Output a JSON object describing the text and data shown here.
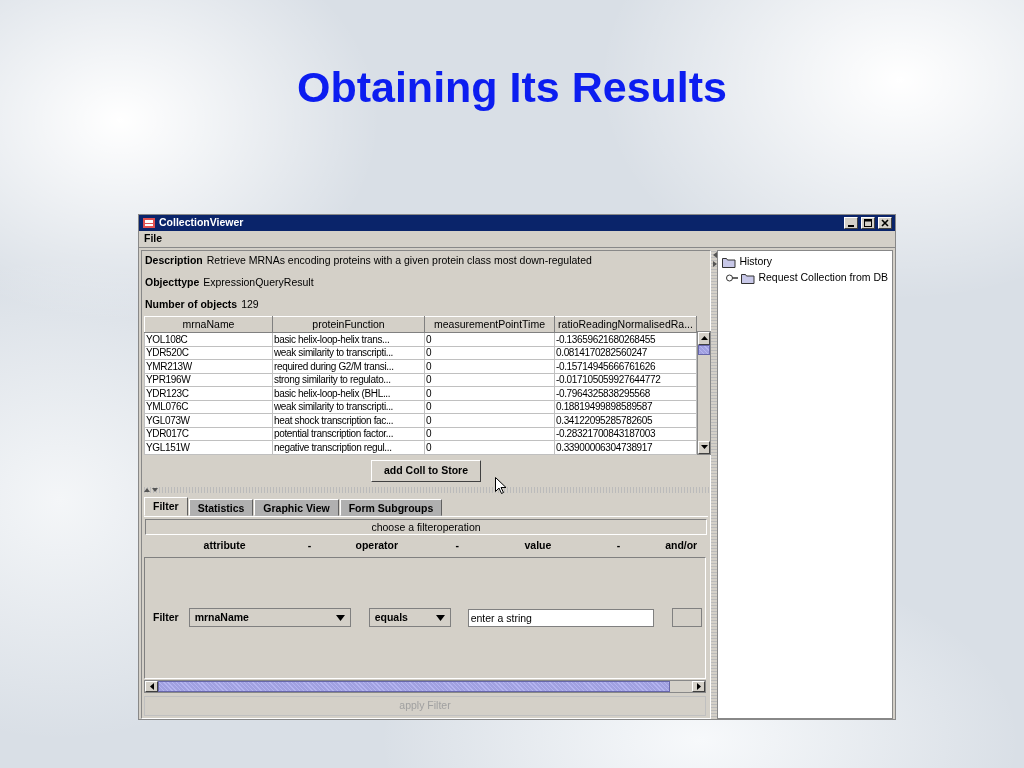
{
  "slide": {
    "title": "Obtaining Its Results"
  },
  "window": {
    "title": "CollectionViewer"
  },
  "menu": [
    "File"
  ],
  "info": [
    {
      "label": "Description",
      "value": "Retrieve MRNAs encoding proteins with a given protein class most down-regulated"
    },
    {
      "label": "Objecttype",
      "value": "ExpressionQueryResult"
    },
    {
      "label": "Number of objects",
      "value": "129"
    }
  ],
  "table": {
    "columns": [
      "mrnaName",
      "proteinFunction",
      "measurementPointTime",
      "ratioReadingNormalisedRa..."
    ],
    "rows": [
      [
        "YOL108C",
        "basic helix-loop-helix trans...",
        "0",
        "-0.13659621680268455"
      ],
      [
        "YDR520C",
        "weak similarity to transcripti...",
        "0",
        "0.0814170282560247"
      ],
      [
        "YMR213W",
        "required during G2/M transi...",
        "0",
        "-0.15714945666761626"
      ],
      [
        "YPR196W",
        "strong similarity to regulato...",
        "0",
        "-0.017105059927644772"
      ],
      [
        "YDR123C",
        "basic helix-loop-helix (BHL...",
        "0",
        "-0.7964325838295568"
      ],
      [
        "YML076C",
        "weak similarity to transcripti...",
        "0",
        "0.18819499898589587"
      ],
      [
        "YGL073W",
        "heat shock transcription fac...",
        "0",
        "0.34122095285782605"
      ],
      [
        "YDR017C",
        "potential transcription factor...",
        "0",
        "-0.28321700843187003"
      ],
      [
        "YGL151W",
        "negative transcription regul...",
        "0",
        "0.33900006304738917"
      ]
    ]
  },
  "add_button": "add Coll to Store",
  "tabs": [
    {
      "label": "Filter",
      "selected": true
    },
    {
      "label": "Statistics",
      "selected": false
    },
    {
      "label": "Graphic View",
      "selected": false
    },
    {
      "label": "Form Subgroups",
      "selected": false
    }
  ],
  "filter": {
    "hint": "choose a filteroperation",
    "headers": [
      "attribute",
      "-",
      "operator",
      "-",
      "value",
      "-",
      "and/or"
    ],
    "label": "Filter",
    "attribute": "mrnaName",
    "operator": "equals",
    "value": "enter a string"
  },
  "apply_button": {
    "label": "apply Filter",
    "disabled": true
  },
  "tree": {
    "label": "History",
    "children": [
      {
        "label": "Request Collection from DB",
        "expanded": false
      }
    ]
  }
}
